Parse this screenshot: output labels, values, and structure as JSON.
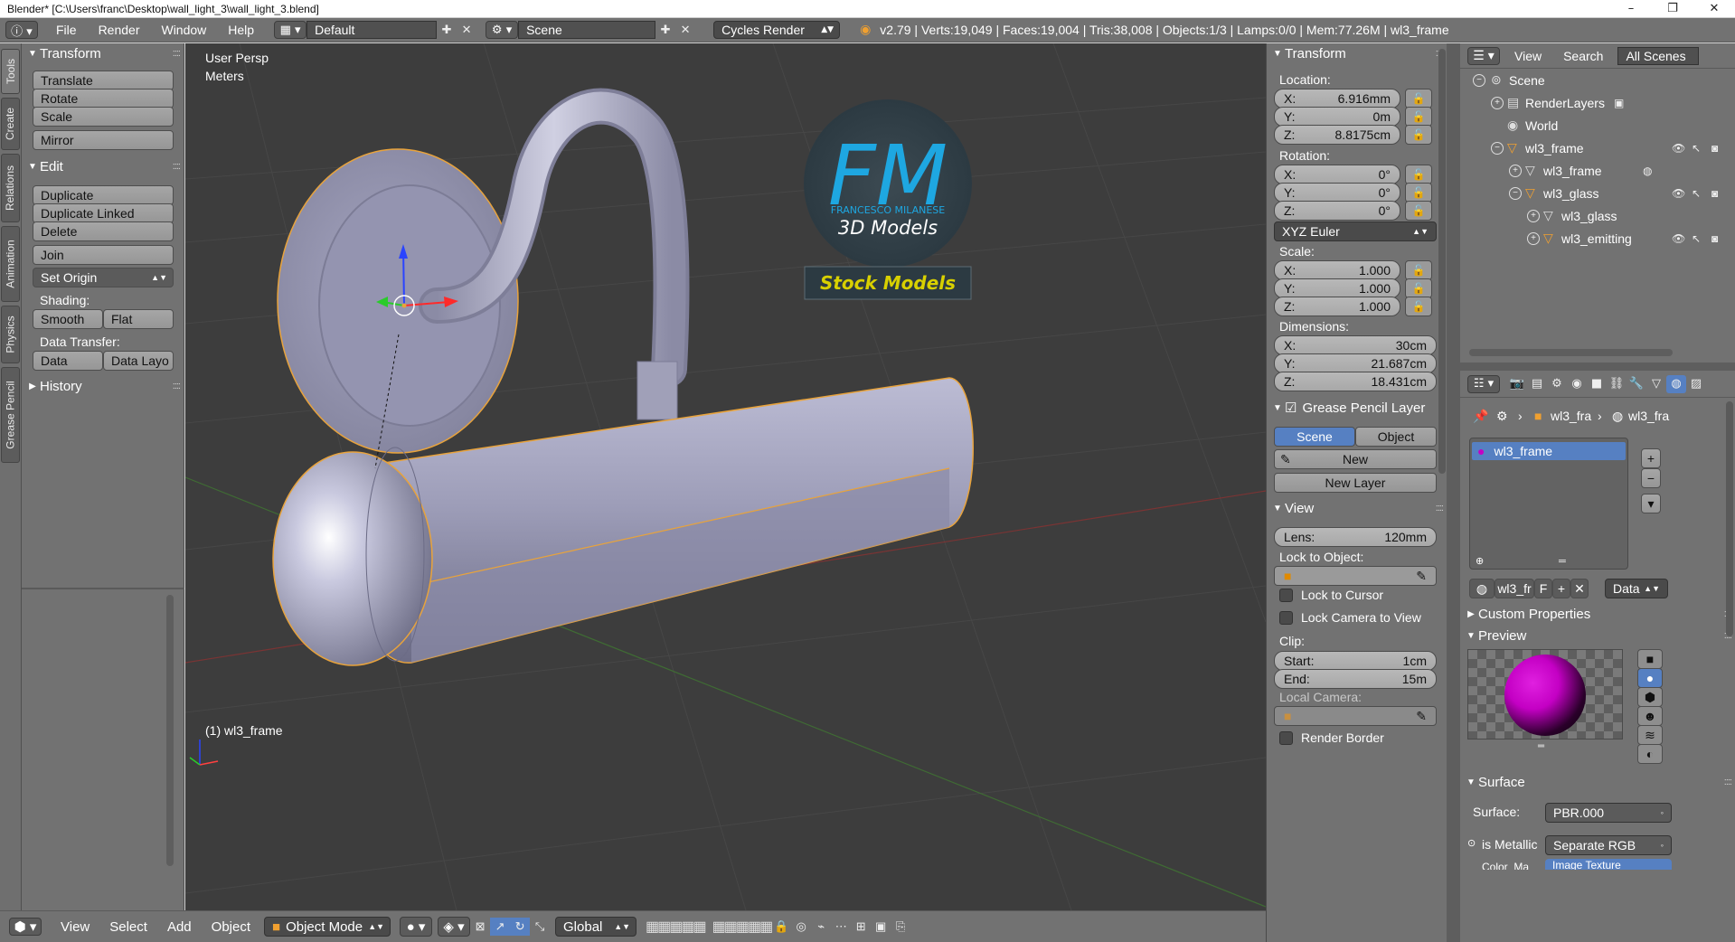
{
  "window": {
    "title": "Blender* [C:\\Users\\franc\\Desktop\\wall_light_3\\wall_light_3.blend]",
    "minimize": "–",
    "maximize": "❐",
    "close": "✕"
  },
  "infobar": {
    "menus": [
      "File",
      "Render",
      "Window",
      "Help"
    ],
    "screen_layout": "Default",
    "scene": "Scene",
    "render_engine": "Cycles Render",
    "stats": "v2.79 | Verts:19,049 | Faces:19,004 | Tris:38,008 | Objects:1/3 | Lamps:0/0 | Mem:77.26M | wl3_frame"
  },
  "vertical_tabs": [
    "Tools",
    "Create",
    "Relations",
    "Animation",
    "Physics",
    "Grease Pencil"
  ],
  "toolshelf": {
    "transform_header": "Transform",
    "transform_buttons": [
      "Translate",
      "Rotate",
      "Scale"
    ],
    "mirror": "Mirror",
    "edit_header": "Edit",
    "edit_buttons": [
      "Duplicate",
      "Duplicate Linked",
      "Delete"
    ],
    "join": "Join",
    "set_origin": "Set Origin",
    "shading_label": "Shading:",
    "smooth": "Smooth",
    "flat": "Flat",
    "data_transfer_label": "Data Transfer:",
    "data": "Data",
    "data_layout": "Data Layo",
    "history_header": "History"
  },
  "viewport": {
    "view_name": "User Persp",
    "units": "Meters",
    "active_object": "(1) wl3_frame",
    "logo_letters": "FM",
    "logo_company": "FRANCESCO MILANESE",
    "logo_subtitle": "3D Models",
    "stock_models": "Stock Models"
  },
  "viewport_header": {
    "menus": [
      "View",
      "Select",
      "Add",
      "Object"
    ],
    "mode": "Object Mode",
    "orientation": "Global"
  },
  "npanel": {
    "transform_header": "Transform",
    "location_label": "Location:",
    "location": [
      {
        "axis": "X:",
        "value": "6.916mm"
      },
      {
        "axis": "Y:",
        "value": "0m"
      },
      {
        "axis": "Z:",
        "value": "8.8175cm"
      }
    ],
    "rotation_label": "Rotation:",
    "rotation": [
      {
        "axis": "X:",
        "value": "0°"
      },
      {
        "axis": "Y:",
        "value": "0°"
      },
      {
        "axis": "Z:",
        "value": "0°"
      }
    ],
    "rotation_mode": "XYZ Euler",
    "scale_label": "Scale:",
    "scale": [
      {
        "axis": "X:",
        "value": "1.000"
      },
      {
        "axis": "Y:",
        "value": "1.000"
      },
      {
        "axis": "Z:",
        "value": "1.000"
      }
    ],
    "dimensions_label": "Dimensions:",
    "dimensions": [
      {
        "axis": "X:",
        "value": "30cm"
      },
      {
        "axis": "Y:",
        "value": "21.687cm"
      },
      {
        "axis": "Z:",
        "value": "18.431cm"
      }
    ],
    "grease_pencil_header": "Grease Pencil Layer",
    "gp_scene": "Scene",
    "gp_object": "Object",
    "gp_new": "New",
    "gp_new_layer": "New Layer",
    "view_header": "View",
    "lens_label": "Lens:",
    "lens_value": "120mm",
    "lock_to_object_label": "Lock to Object:",
    "lock_to_cursor": "Lock to Cursor",
    "lock_camera_to_view": "Lock Camera to View",
    "clip_label": "Clip:",
    "clip_start_label": "Start:",
    "clip_start_value": "1cm",
    "clip_end_label": "End:",
    "clip_end_value": "15m",
    "local_camera_label": "Local Camera:",
    "render_border": "Render Border"
  },
  "outliner": {
    "menus": [
      "View",
      "Search"
    ],
    "display_mode": "All Scenes",
    "rows": [
      {
        "label": "Scene"
      },
      {
        "label": "RenderLayers"
      },
      {
        "label": "World"
      },
      {
        "label": "wl3_frame"
      },
      {
        "label": "wl3_frame"
      },
      {
        "label": "wl3_glass"
      },
      {
        "label": "wl3_glass"
      },
      {
        "label": "wl3_emitting"
      }
    ]
  },
  "properties": {
    "breadcrumb_1": "wl3_fra",
    "breadcrumb_2": "wl3_fra",
    "material_slot": "wl3_frame",
    "material_name": "wl3_fr",
    "fake_user": "F",
    "link_mode": "Data",
    "custom_properties": "Custom Properties",
    "preview_header": "Preview",
    "surface_header": "Surface",
    "surface_label": "Surface:",
    "surface_value": "PBR.000",
    "is_metallic_label": "is Metallic",
    "is_metallic_value": "Separate RGB",
    "next_row_label": "Color_Ma",
    "next_row_value": "Image Texture"
  },
  "colors": {
    "accent_blue": "#5680c2",
    "viewport_bg": "#3d3d3d",
    "panel_bg": "#727272",
    "selection_outline": "#e8a33c",
    "logo_blue": "#1ea7e1",
    "stock_models_yellow": "#d8d000",
    "preview_magenta": "#c400c4"
  }
}
